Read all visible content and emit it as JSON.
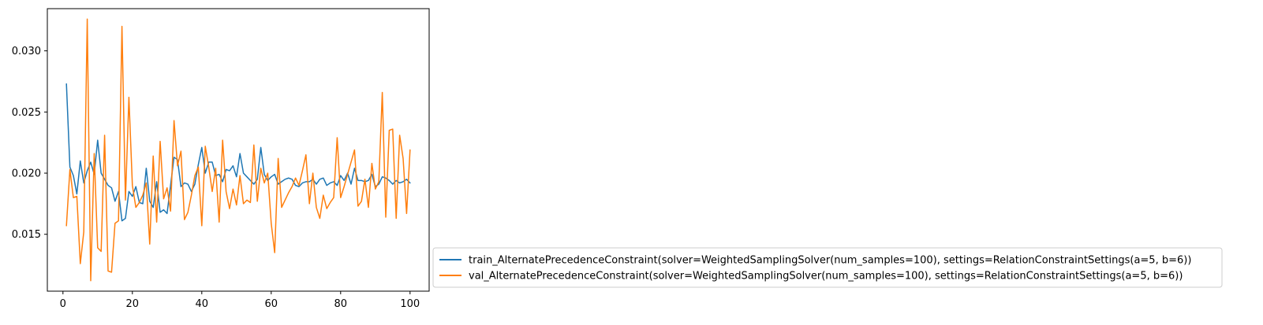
{
  "chart_data": {
    "type": "line",
    "title": "",
    "xlabel": "",
    "ylabel": "",
    "xlim": [
      -4.5,
      105.5
    ],
    "ylim": [
      0.01035,
      0.03345
    ],
    "xticks": [
      0,
      20,
      40,
      60,
      80,
      100
    ],
    "yticks": [
      0.015,
      0.02,
      0.025,
      0.03
    ],
    "xtick_labels": [
      "0",
      "20",
      "40",
      "60",
      "80",
      "100"
    ],
    "ytick_labels": [
      "0.015",
      "0.020",
      "0.025",
      "0.030"
    ],
    "grid": false,
    "legend_position": "outside-right-bottom",
    "x": [
      1,
      2,
      3,
      4,
      5,
      6,
      7,
      8,
      9,
      10,
      11,
      12,
      13,
      14,
      15,
      16,
      17,
      18,
      19,
      20,
      21,
      22,
      23,
      24,
      25,
      26,
      27,
      28,
      29,
      30,
      31,
      32,
      33,
      34,
      35,
      36,
      37,
      38,
      39,
      40,
      41,
      42,
      43,
      44,
      45,
      46,
      47,
      48,
      49,
      50,
      51,
      52,
      53,
      54,
      55,
      56,
      57,
      58,
      59,
      60,
      61,
      62,
      63,
      64,
      65,
      66,
      67,
      68,
      69,
      70,
      71,
      72,
      73,
      74,
      75,
      76,
      77,
      78,
      79,
      80,
      81,
      82,
      83,
      84,
      85,
      86,
      87,
      88,
      89,
      90,
      91,
      92,
      93,
      94,
      95,
      96,
      97,
      98,
      99,
      100
    ],
    "series": [
      {
        "name": "train_AlternatePrecedenceConstraint(solver=WeightedSamplingSolver(num_samples=100), settings=RelationConstraintSettings(a=5, b=6))",
        "color": "#1f77b4",
        "values": [
          0.0273,
          0.0205,
          0.0198,
          0.0183,
          0.021,
          0.0192,
          0.0202,
          0.0209,
          0.0199,
          0.0227,
          0.02,
          0.0195,
          0.019,
          0.0188,
          0.0177,
          0.0185,
          0.0161,
          0.0163,
          0.0185,
          0.0181,
          0.0189,
          0.0176,
          0.0175,
          0.0204,
          0.0177,
          0.0172,
          0.0193,
          0.0168,
          0.017,
          0.0167,
          0.019,
          0.0213,
          0.0211,
          0.0189,
          0.0192,
          0.0191,
          0.0185,
          0.0191,
          0.0207,
          0.0221,
          0.02,
          0.0209,
          0.0209,
          0.0198,
          0.0199,
          0.0193,
          0.0203,
          0.0202,
          0.0206,
          0.0197,
          0.0216,
          0.02,
          0.0197,
          0.0194,
          0.0191,
          0.0195,
          0.0221,
          0.0199,
          0.0194,
          0.0197,
          0.0199,
          0.0191,
          0.0193,
          0.0195,
          0.0196,
          0.0195,
          0.019,
          0.0189,
          0.0192,
          0.0193,
          0.0193,
          0.0195,
          0.0191,
          0.0195,
          0.0196,
          0.019,
          0.0192,
          0.0193,
          0.019,
          0.0198,
          0.0194,
          0.02,
          0.0191,
          0.0204,
          0.0194,
          0.0194,
          0.0193,
          0.0194,
          0.0199,
          0.0189,
          0.0191,
          0.0197,
          0.0196,
          0.0194,
          0.0191,
          0.0194,
          0.0192,
          0.0193,
          0.0195,
          0.0192
        ]
      },
      {
        "name": "val_AlternatePrecedenceConstraint(solver=WeightedSamplingSolver(num_samples=100), settings=RelationConstraintSettings(a=5, b=6))",
        "color": "#ff7f0e",
        "values": [
          0.0157,
          0.0203,
          0.018,
          0.0181,
          0.0126,
          0.0152,
          0.0326,
          0.0112,
          0.0216,
          0.0139,
          0.0136,
          0.0231,
          0.012,
          0.0119,
          0.0159,
          0.0161,
          0.032,
          0.0178,
          0.0262,
          0.019,
          0.0172,
          0.0176,
          0.0182,
          0.0192,
          0.0142,
          0.0214,
          0.016,
          0.0226,
          0.0179,
          0.0188,
          0.0169,
          0.0243,
          0.0206,
          0.0218,
          0.0162,
          0.0168,
          0.0182,
          0.0198,
          0.0205,
          0.0157,
          0.0222,
          0.0205,
          0.0185,
          0.0204,
          0.016,
          0.0227,
          0.0185,
          0.0171,
          0.0187,
          0.0174,
          0.0198,
          0.0175,
          0.0178,
          0.0176,
          0.0223,
          0.0177,
          0.0204,
          0.0192,
          0.02,
          0.0159,
          0.0135,
          0.0212,
          0.0172,
          0.0178,
          0.0184,
          0.0189,
          0.0196,
          0.019,
          0.0202,
          0.0215,
          0.0175,
          0.02,
          0.0172,
          0.0163,
          0.0182,
          0.0171,
          0.0176,
          0.018,
          0.0229,
          0.018,
          0.0189,
          0.0199,
          0.0209,
          0.0219,
          0.0173,
          0.0177,
          0.0195,
          0.0172,
          0.0208,
          0.0187,
          0.0193,
          0.0266,
          0.0164,
          0.0235,
          0.0236,
          0.0163,
          0.0231,
          0.0212,
          0.0167,
          0.0219
        ]
      }
    ]
  }
}
